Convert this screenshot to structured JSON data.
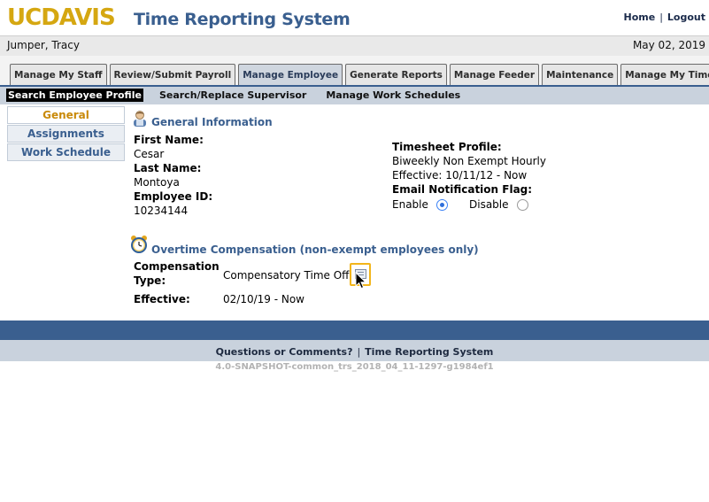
{
  "header": {
    "logo_uc": "UC",
    "logo_davis": "DAVIS",
    "app_title": "Time Reporting System",
    "links": {
      "home": "Home",
      "separator": "|",
      "logout": "Logout"
    }
  },
  "user_bar": {
    "name": "Jumper, Tracy",
    "date": "May 02, 2019"
  },
  "main_tabs": [
    {
      "label": "Manage My Staff",
      "active": false
    },
    {
      "label": "Review/Submit Payroll",
      "active": false
    },
    {
      "label": "Manage Employee",
      "active": true
    },
    {
      "label": "Generate Reports",
      "active": false
    },
    {
      "label": "Manage Feeder",
      "active": false
    },
    {
      "label": "Maintenance",
      "active": false
    },
    {
      "label": "Manage My Time",
      "active": false
    }
  ],
  "sub_tabs": [
    {
      "label": "Search Employee Profile",
      "active": true
    },
    {
      "label": "Search/Replace Supervisor",
      "active": false
    },
    {
      "label": "Manage Work Schedules",
      "active": false
    }
  ],
  "left_nav": [
    {
      "label": "General",
      "active": true
    },
    {
      "label": "Assignments",
      "active": false
    },
    {
      "label": "Work Schedule",
      "active": false
    }
  ],
  "general_info": {
    "heading": "General Information",
    "first_name_label": "First Name:",
    "first_name": "Cesar",
    "last_name_label": "Last Name:",
    "last_name": "Montoya",
    "employee_id_label": "Employee ID:",
    "employee_id": "10234144",
    "timesheet_profile_label": "Timesheet Profile:",
    "timesheet_profile": "Biweekly Non Exempt Hourly",
    "timesheet_effective": "Effective: 10/11/12 - Now",
    "email_flag_label": "Email Notification Flag:",
    "enable_label": "Enable",
    "disable_label": "Disable",
    "email_flag_selected": "Enable"
  },
  "overtime": {
    "heading": "Overtime Compensation (non-exempt employees only)",
    "comp_type_label_line1": "Compensation",
    "comp_type_label_line2": "Type:",
    "comp_type_value": "Compensatory Time Off",
    "effective_label": "Effective:",
    "effective_value": "02/10/19 - Now"
  },
  "footer": {
    "questions": "Questions or Comments?",
    "separator": "|",
    "system_link": "Time Reporting System",
    "build": "4.0-SNAPSHOT-common_trs_2018_04_11-1297-g1984ef1"
  },
  "colors": {
    "brand_gold": "#d5a711",
    "brand_blue": "#3a5f8f",
    "subbar": "#c9d2dd",
    "active_nav_text": "#c98a0a",
    "edit_highlight": "#f2b51b"
  },
  "icons": {
    "general_info": "user-icon",
    "overtime": "alarm-clock-icon",
    "edit": "edit-document-icon"
  }
}
